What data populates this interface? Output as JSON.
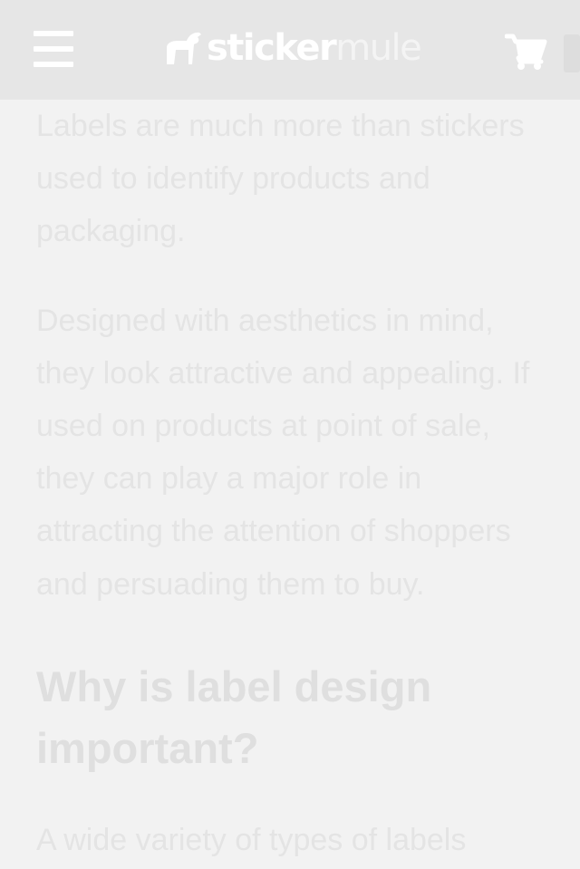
{
  "header": {
    "logo": {
      "part1": "sticker",
      "part2": "mule"
    },
    "menu_icon": "hamburger-menu-icon",
    "cart_icon": "shopping-cart-icon"
  },
  "article": {
    "paragraph1": "Labels are much more than stickers used to identify products and packaging.",
    "paragraph2": "Designed with aesthetics in mind, they look attractive and appealing. If used on products at point of sale, they can play a major role in attracting the attention of shoppers and persuading them to buy.",
    "heading": "Why is label design important?",
    "paragraph3_partial": "A wide variety of types of labels"
  },
  "colors": {
    "header_bg": "#e6e6e6",
    "page_bg": "#f2f2f2",
    "text": "#e4e4e4"
  }
}
